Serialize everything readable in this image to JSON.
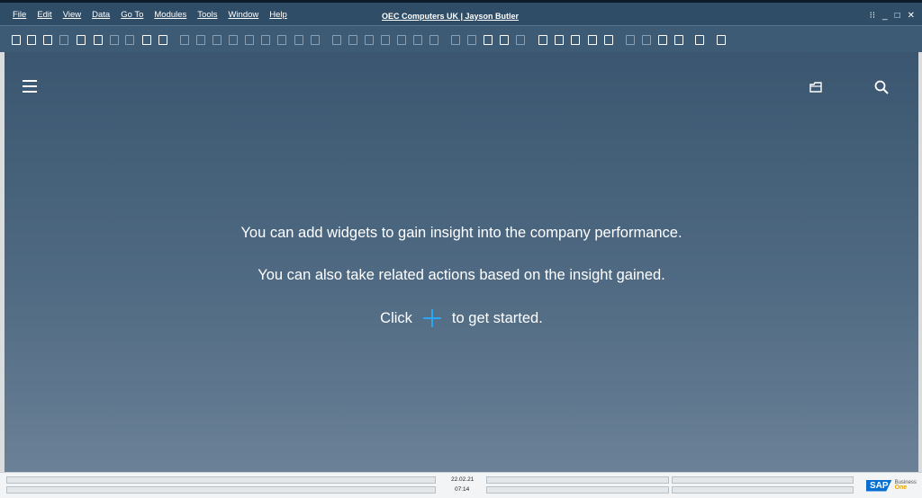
{
  "menu": [
    "File",
    "Edit",
    "View",
    "Data",
    "Go To",
    "Modules",
    "Tools",
    "Window",
    "Help"
  ],
  "window_title": "OEC Computers UK | Jayson Butler",
  "window_controls": [
    "⁝⁝",
    "_",
    "□",
    "✕"
  ],
  "dashboard": {
    "line1": "You can add widgets to gain insight into the company performance.",
    "line2": "You can also take related actions based on the insight gained.",
    "click_prefix": "Click",
    "click_suffix": "to get started."
  },
  "status": {
    "date": "22.02.21",
    "time": "07:14"
  },
  "brand": {
    "logo": "SAP",
    "product_line1": "Business",
    "product_line2": "One"
  },
  "colors": {
    "accent_plus": "#2aa7f0",
    "titlebar": "#2f4d66",
    "dashboard_top": "#3b5670"
  },
  "icons": {
    "menu": "hamburger-icon",
    "open": "folder-icon",
    "search": "search-icon",
    "add": "plus-icon"
  }
}
